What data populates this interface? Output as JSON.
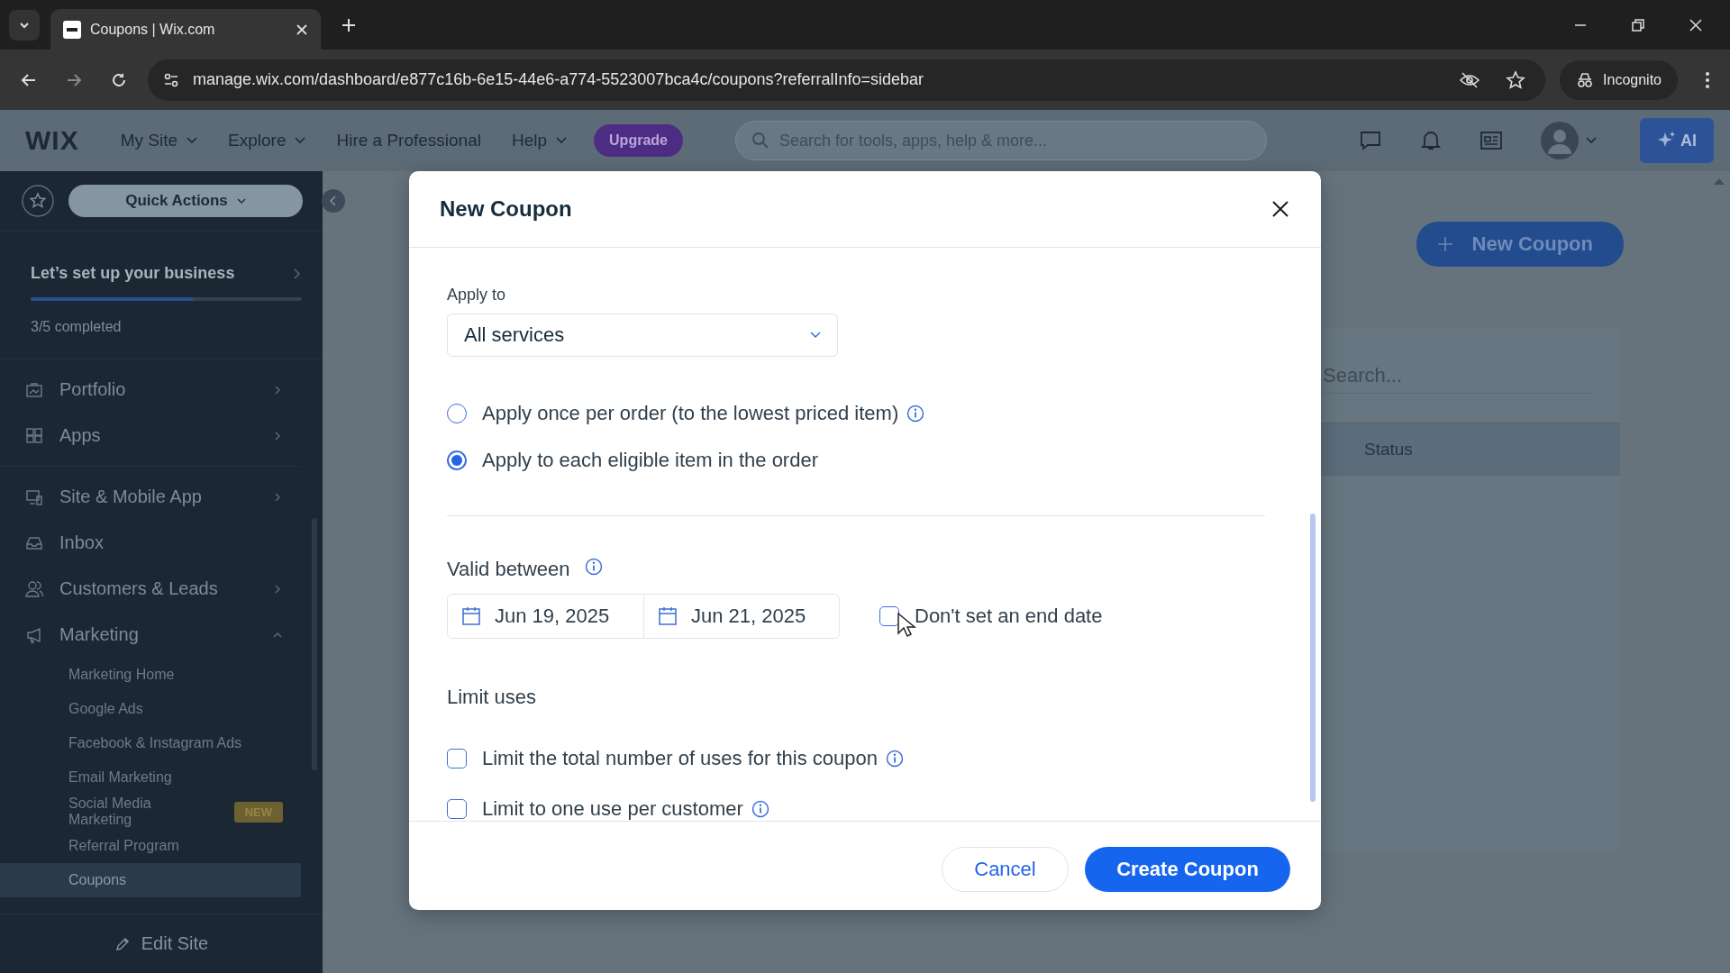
{
  "browser": {
    "tab_title": "Coupons | Wix.com",
    "url": "manage.wix.com/dashboard/e877c16b-6e15-44e6-a774-5523007bca4c/coupons?referralInfo=sidebar",
    "incognito": "Incognito"
  },
  "topbar": {
    "logo": "WIX",
    "menu": [
      {
        "label": "My Site",
        "dropdown": true
      },
      {
        "label": "Explore",
        "dropdown": true
      },
      {
        "label": "Hire a Professional",
        "dropdown": false
      },
      {
        "label": "Help",
        "dropdown": true
      }
    ],
    "upgrade": "Upgrade",
    "search_placeholder": "Search for tools, apps, help & more...",
    "ai": "AI"
  },
  "sidebar": {
    "quick_actions": "Quick Actions",
    "setup": {
      "title": "Let’s set up your business",
      "level": 0.6,
      "progress": "3/5 completed"
    },
    "sections": [
      {
        "items": [
          {
            "label": "Portfolio",
            "expandable": true
          },
          {
            "label": "Apps",
            "expandable": true
          }
        ]
      },
      {
        "items": [
          {
            "label": "Site & Mobile App",
            "expandable": true
          },
          {
            "label": "Inbox",
            "expandable": false
          },
          {
            "label": "Customers & Leads",
            "expandable": true
          },
          {
            "label": "Marketing",
            "expandable": true,
            "expanded": true,
            "children": [
              {
                "label": "Marketing Home",
                "selected": false
              },
              {
                "label": "Google Ads",
                "selected": false
              },
              {
                "label": "Facebook & Instagram Ads",
                "selected": false
              },
              {
                "label": "Email Marketing",
                "selected": false
              },
              {
                "label": "Social Media Marketing",
                "selected": false,
                "badge": "NEW"
              },
              {
                "label": "Referral Program",
                "selected": false
              },
              {
                "label": "Coupons",
                "selected": true
              }
            ]
          }
        ]
      }
    ],
    "edit_site": "Edit Site"
  },
  "page": {
    "new_coupon": "New Coupon",
    "search_placeholder": "Search...",
    "columns": [
      "Status"
    ]
  },
  "modal": {
    "title": "New Coupon",
    "apply_to": {
      "label": "Apply to",
      "value": "All services"
    },
    "radios": [
      {
        "label": "Apply once per order (to the lowest priced item)",
        "info": true,
        "selected": false
      },
      {
        "label": "Apply to each eligible item in the order",
        "info": false,
        "selected": true
      }
    ],
    "valid_between": {
      "label": "Valid between",
      "info": true,
      "dates": [
        "Jun 19, 2025",
        "Jun 21, 2025"
      ],
      "no_end_date": {
        "label": "Don't set an end date",
        "checked": false
      }
    },
    "limit_uses": {
      "label": "Limit uses",
      "options": [
        {
          "label": "Limit the total number of uses for this coupon",
          "info": true,
          "checked": false
        },
        {
          "label": "Limit to one use per customer",
          "info": true,
          "checked": false
        }
      ]
    },
    "cancel": "Cancel",
    "create": "Create Coupon"
  }
}
